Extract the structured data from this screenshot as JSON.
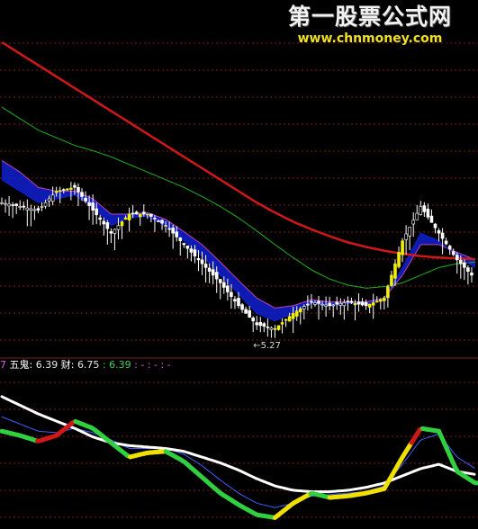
{
  "watermark": {
    "title": "第一股票公式网",
    "url": "www.chnmoney.com"
  },
  "indicator_legend": {
    "index_digit": "7",
    "name1": "五鬼:",
    "value1": "6.39",
    "name2": "财:",
    "value2": "6.75",
    "value3": ": 6.39",
    "tail": ": - : - : -"
  },
  "colors": {
    "background": "#000000",
    "grid": "#7a1e1e",
    "candle_body": "#ffffff",
    "ma_long": "#d01818",
    "ma_mid": "#20b020",
    "ribbon_blue": "#1020d0",
    "ribbon_magenta": "#c040c0",
    "highlight_yellow": "#f0f000"
  },
  "chart_data": [
    {
      "type": "line",
      "panel": "main price (candlestick)",
      "annotation": "←5.27",
      "low_marker": 5.27,
      "x": [
        0,
        20,
        40,
        60,
        80,
        100,
        120,
        140,
        160,
        180,
        200,
        220,
        240,
        260,
        280,
        300,
        320,
        340,
        360,
        380,
        400,
        420,
        440,
        460,
        480,
        500,
        520
      ],
      "series": [
        {
          "color": "#ffffff",
          "values": [
            7.1,
            7.05,
            7.0,
            7.25,
            7.3,
            7.0,
            6.7,
            6.95,
            6.95,
            6.8,
            6.55,
            6.3,
            6.05,
            5.75,
            5.5,
            5.45,
            5.65,
            5.8,
            5.75,
            5.8,
            5.75,
            5.85,
            6.6,
            7.05,
            6.7,
            6.35,
            6.1
          ]
        },
        {
          "color": "#d01818",
          "values": [
            9.2,
            9.05,
            8.9,
            8.75,
            8.6,
            8.45,
            8.3,
            8.15,
            8.0,
            7.85,
            7.7,
            7.55,
            7.4,
            7.25,
            7.1,
            6.97,
            6.85,
            6.75,
            6.66,
            6.58,
            6.52,
            6.47,
            6.43,
            6.4,
            6.38,
            6.37,
            6.36
          ]
        },
        {
          "color": "#20b020",
          "values": [
            8.35,
            8.2,
            8.05,
            7.95,
            7.85,
            7.78,
            7.7,
            7.6,
            7.5,
            7.4,
            7.3,
            7.18,
            7.05,
            6.9,
            6.73,
            6.55,
            6.38,
            6.22,
            6.1,
            6.02,
            5.98,
            6.0,
            6.05,
            6.15,
            6.25,
            6.3,
            6.32
          ]
        },
        {
          "color": "#1020d0",
          "values": [
            7.4,
            7.25,
            7.1,
            7.15,
            7.2,
            7.05,
            6.8,
            6.9,
            6.92,
            6.8,
            6.6,
            6.4,
            6.15,
            5.9,
            5.65,
            5.55,
            5.65,
            5.78,
            5.75,
            5.78,
            5.77,
            5.83,
            6.25,
            6.7,
            6.6,
            6.4,
            6.25
          ]
        },
        {
          "color": "#c040c0",
          "values": [
            7.65,
            7.5,
            7.3,
            7.25,
            7.25,
            7.15,
            6.95,
            6.95,
            6.97,
            6.88,
            6.72,
            6.55,
            6.32,
            6.08,
            5.85,
            5.72,
            5.75,
            5.83,
            5.8,
            5.8,
            5.8,
            5.85,
            6.15,
            6.55,
            6.55,
            6.45,
            6.35
          ]
        }
      ]
    },
    {
      "type": "line",
      "panel": "indicator (五鬼 / 财)",
      "x": [
        0,
        20,
        40,
        60,
        80,
        100,
        120,
        140,
        160,
        180,
        200,
        220,
        240,
        260,
        280,
        300,
        320,
        340,
        360,
        380,
        400,
        420,
        440,
        460,
        480,
        500,
        520
      ],
      "series": [
        {
          "color": "#ffffff",
          "values": [
            0.72,
            0.66,
            0.6,
            0.55,
            0.5,
            0.44,
            0.4,
            0.38,
            0.37,
            0.36,
            0.34,
            0.3,
            0.26,
            0.21,
            0.15,
            0.1,
            0.07,
            0.06,
            0.06,
            0.07,
            0.09,
            0.12,
            0.17,
            0.22,
            0.25,
            0.2,
            0.18
          ]
        },
        {
          "color": "#30d040",
          "values": [
            0.48,
            0.45,
            0.41,
            0.45,
            0.55,
            0.5,
            0.4,
            0.3,
            0.33,
            0.34,
            0.27,
            0.16,
            0.05,
            -0.03,
            -0.1,
            -0.12,
            -0.02,
            0.05,
            0.02,
            0.03,
            0.05,
            0.08,
            0.3,
            0.5,
            0.48,
            0.2,
            0.12
          ]
        },
        {
          "color": "#4060ff",
          "values": [
            0.58,
            0.53,
            0.48,
            0.47,
            0.5,
            0.47,
            0.42,
            0.36,
            0.36,
            0.36,
            0.32,
            0.24,
            0.14,
            0.05,
            -0.02,
            -0.05,
            -0.02,
            0.03,
            0.04,
            0.05,
            0.06,
            0.1,
            0.25,
            0.42,
            0.46,
            0.3,
            0.22
          ]
        }
      ]
    }
  ]
}
